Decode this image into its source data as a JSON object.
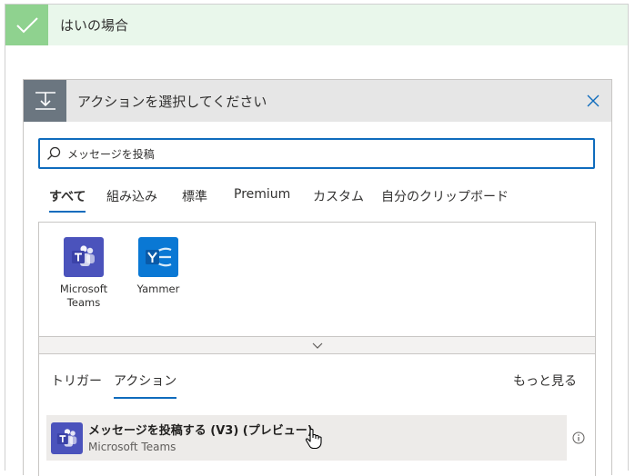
{
  "condition": {
    "title": "はいの場合"
  },
  "action_picker": {
    "title": "アクションを選択してください",
    "search": {
      "value": "メッセージを投稿",
      "placeholder": ""
    },
    "tabs": [
      {
        "label": "すべて",
        "active": true
      },
      {
        "label": "組み込み",
        "active": false
      },
      {
        "label": "標準",
        "active": false
      },
      {
        "label": "Premium",
        "active": false
      },
      {
        "label": "カスタム",
        "active": false
      },
      {
        "label": "自分のクリップボード",
        "active": false
      }
    ],
    "connectors": [
      {
        "name_line1": "Microsoft",
        "name_line2": "Teams",
        "color": "#4b53bc"
      },
      {
        "name_line1": "Yammer",
        "name_line2": "",
        "color": "#0a78d4"
      }
    ],
    "subtabs": [
      {
        "label": "トリガー",
        "active": false
      },
      {
        "label": "アクション",
        "active": true
      }
    ],
    "see_more": "もっと見る",
    "actions": [
      {
        "title": "メッセージを投稿する (V3) (プレビュー)",
        "connector": "Microsoft Teams"
      }
    ]
  },
  "colors": {
    "accent": "#0f6cbd",
    "success": "#8fd28f",
    "success_bg": "#e9f7eb",
    "header_gray": "#6b7680"
  }
}
